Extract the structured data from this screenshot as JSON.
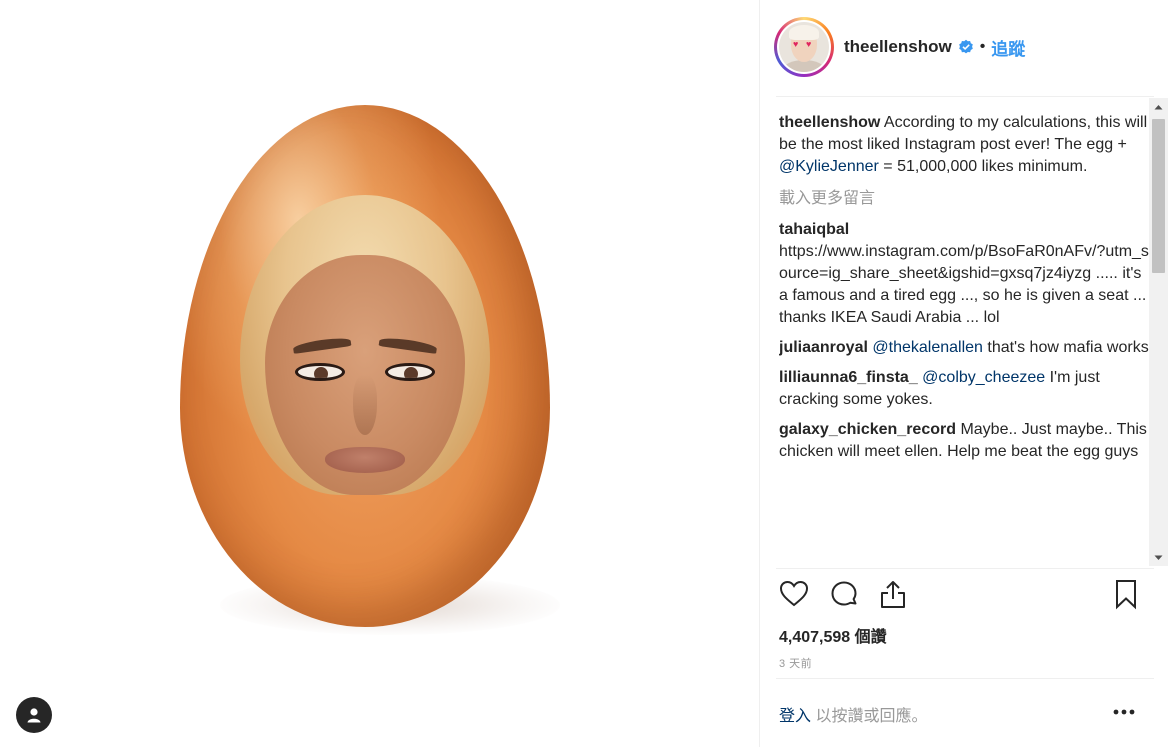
{
  "post": {
    "username": "theellenshow",
    "verified": true,
    "follow_label": "追蹤",
    "separator": "•",
    "icons": {
      "verified": "verified-badge-icon",
      "like": "heart-icon",
      "comment": "comment-icon",
      "share": "share-icon",
      "save": "bookmark-icon",
      "more": "more-options-icon",
      "profile": "profile-icon"
    }
  },
  "caption": {
    "username": "theellenshow",
    "text_before": " According to my calculations, this will be the most liked Instagram post ever! The egg + ",
    "mention": "@KylieJenner",
    "text_after": " = 51,000,000 likes minimum."
  },
  "load_more_label": "載入更多留言",
  "comments": [
    {
      "username": "tahaiqbal",
      "text": "https://www.instagram.com/p/BsoFaR0nAFv/?utm_source=ig_share_sheet&igshid=gxsq7jz4iyzg ..... it's a famous and a tired egg ..., so he is given a seat ... thanks IKEA Saudi Arabia ... lol"
    },
    {
      "username": "juliaanroyal",
      "mention": "@thekalenallen",
      "text": " that's how mafia works"
    },
    {
      "username": "lilliaunna6_finsta_",
      "mention": "@colby_cheezee",
      "text": " I'm just cracking some yokes."
    },
    {
      "username": "galaxy_chicken_record",
      "text": " Maybe.. Just maybe.. This chicken will meet ellen. Help me beat the egg guys"
    }
  ],
  "likes": {
    "count": "4,407,598",
    "unit": " 個讚"
  },
  "time_ago": "3 天前",
  "login": {
    "link": "登入",
    "rest": " 以按讚或回應。"
  },
  "colors": {
    "accent": "#3897f0",
    "mention": "#003569",
    "muted": "#999999",
    "egg": "#e58a45"
  }
}
